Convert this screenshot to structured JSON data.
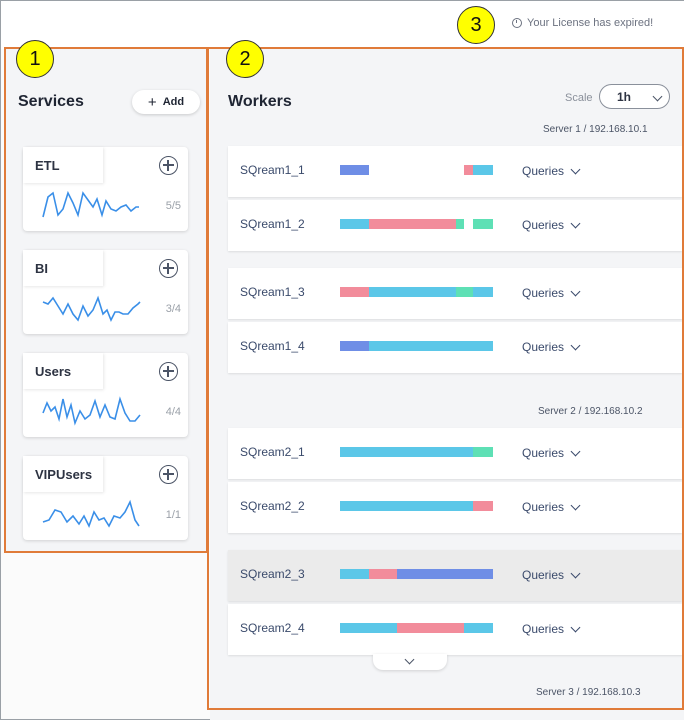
{
  "license_notice": "Your License has expired!",
  "badges": [
    "1",
    "2",
    "3"
  ],
  "services": {
    "title": "Services",
    "add_label": "Add",
    "items": [
      {
        "name": "ETL",
        "count": "5/5"
      },
      {
        "name": "BI",
        "count": "3/4"
      },
      {
        "name": "Users",
        "count": "4/4"
      },
      {
        "name": "VIPUsers",
        "count": "1/1"
      }
    ]
  },
  "workers": {
    "title": "Workers",
    "scale_label": "Scale",
    "scale_value": "1h",
    "queries_label": "Queries",
    "servers": [
      {
        "label": "Server 1 / 192.168.10.1",
        "workers": [
          {
            "name": "SQream1_1",
            "bar": [
              [
                "#6f8ee6",
                0.19
              ],
              [
                "#ffffff",
                0.62
              ],
              [
                "#f28c9b",
                0.06
              ],
              [
                "#5bc7e8",
                0.13
              ]
            ]
          },
          {
            "name": "SQream1_2",
            "bar": [
              [
                "#5bc7e8",
                0.19
              ],
              [
                "#f28c9b",
                0.57
              ],
              [
                "#5ee0b5",
                0.05
              ],
              [
                "#ffffff",
                0.06
              ],
              [
                "#5ee0b5",
                0.13
              ]
            ]
          },
          {
            "name": "SQream1_3",
            "bar": [
              [
                "#f28c9b",
                0.19
              ],
              [
                "#5bc7e8",
                0.57
              ],
              [
                "#5ee0b5",
                0.11
              ],
              [
                "#5bc7e8",
                0.13
              ]
            ]
          },
          {
            "name": "SQream1_4",
            "bar": [
              [
                "#6f8ee6",
                0.19
              ],
              [
                "#5bc7e8",
                0.81
              ]
            ]
          }
        ]
      },
      {
        "label": "Server 2 / 192.168.10.2",
        "workers": [
          {
            "name": "SQream2_1",
            "bar": [
              [
                "#5bc7e8",
                0.87
              ],
              [
                "#5ee0b5",
                0.13
              ]
            ]
          },
          {
            "name": "SQream2_2",
            "bar": [
              [
                "#5bc7e8",
                0.87
              ],
              [
                "#f28c9b",
                0.13
              ]
            ]
          },
          {
            "name": "SQream2_3",
            "bar": [
              [
                "#5bc7e8",
                0.19
              ],
              [
                "#f28c9b",
                0.18
              ],
              [
                "#6f8ee6",
                0.63
              ]
            ]
          },
          {
            "name": "SQream2_4",
            "bar": [
              [
                "#5bc7e8",
                0.37
              ],
              [
                "#f28c9b",
                0.44
              ],
              [
                "#5bc7e8",
                0.19
              ]
            ]
          }
        ]
      },
      {
        "label": "Server 3 / 192.168.10.3",
        "workers": []
      }
    ]
  }
}
